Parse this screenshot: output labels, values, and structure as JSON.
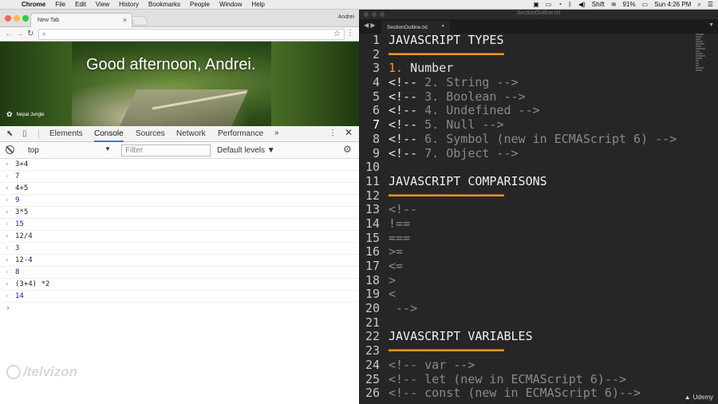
{
  "menubar": {
    "apple_icon": "apple-icon",
    "items": [
      "Chrome",
      "File",
      "Edit",
      "View",
      "History",
      "Bookmarks",
      "People",
      "Window",
      "Help"
    ],
    "status": {
      "shift": "Shift",
      "battery": "91%",
      "clock": "Sun 4:26 PM"
    }
  },
  "chrome": {
    "tab_title": "New Tab",
    "profile": "Andrei",
    "greeting": "Good afternoon, Andrei.",
    "photo_credit": "Nepal Jungle",
    "devtools": {
      "tabs": [
        "Elements",
        "Console",
        "Sources",
        "Network",
        "Performance"
      ],
      "active_tab": "Console",
      "more": "»"
    },
    "console_bar": {
      "context": "top",
      "filter_placeholder": "Filter",
      "levels": "Default levels ▼"
    },
    "console": [
      {
        "kind": "in",
        "text": "3+4"
      },
      {
        "kind": "out",
        "text": "7"
      },
      {
        "kind": "in",
        "text": "4+5"
      },
      {
        "kind": "out",
        "text": "9"
      },
      {
        "kind": "in",
        "text": "3*5"
      },
      {
        "kind": "out",
        "text": "15"
      },
      {
        "kind": "in",
        "text": "12/4"
      },
      {
        "kind": "out",
        "text": "3"
      },
      {
        "kind": "in",
        "text": "12-4"
      },
      {
        "kind": "out",
        "text": "8"
      },
      {
        "kind": "in",
        "text": "(3+4) *2"
      },
      {
        "kind": "out",
        "text": "14"
      }
    ],
    "watermark": "/telvizon"
  },
  "sublime": {
    "window_title": "SectionOutline.txt",
    "tab_title": "SectionOutline.txt",
    "lines": [
      {
        "n": "1",
        "parts": [
          {
            "c": "c-h1",
            "t": "JAVASCRIPT TYPES"
          }
        ]
      },
      {
        "n": "2",
        "parts": [
          {
            "c": "c-rule",
            "t": "━━━━━━━━━━━━━━━━"
          }
        ]
      },
      {
        "n": "3",
        "parts": [
          {
            "c": "c-num",
            "t": "1."
          },
          {
            "c": "c-plain",
            "t": " Number"
          }
        ]
      },
      {
        "n": "4",
        "parts": [
          {
            "c": "c-plain",
            "t": "<!-- "
          },
          {
            "c": "c-comment",
            "t": "2. String -->"
          }
        ]
      },
      {
        "n": "5",
        "parts": [
          {
            "c": "c-plain",
            "t": "<!-- "
          },
          {
            "c": "c-comment",
            "t": "3. Boolean -->"
          }
        ]
      },
      {
        "n": "6",
        "parts": [
          {
            "c": "c-plain",
            "t": "<!-- "
          },
          {
            "c": "c-comment",
            "t": "4. Undefined -->"
          }
        ]
      },
      {
        "n": "7",
        "parts": [
          {
            "c": "c-plain",
            "t": "<!-- "
          },
          {
            "c": "c-comment",
            "t": "5. Null -->"
          }
        ]
      },
      {
        "n": "8",
        "parts": [
          {
            "c": "c-plain",
            "t": "<!-- "
          },
          {
            "c": "c-comment",
            "t": "6. Symbol (new in ECMAScript 6) -->"
          }
        ]
      },
      {
        "n": "9",
        "parts": [
          {
            "c": "c-plain",
            "t": "<!-- "
          },
          {
            "c": "c-comment",
            "t": "7. Object -->"
          }
        ]
      },
      {
        "n": "10",
        "parts": []
      },
      {
        "n": "11",
        "parts": [
          {
            "c": "c-h1",
            "t": "JAVASCRIPT COMPARISONS"
          }
        ]
      },
      {
        "n": "12",
        "parts": [
          {
            "c": "c-rule",
            "t": "━━━━━━━━━━━━━━━━"
          }
        ]
      },
      {
        "n": "13",
        "parts": [
          {
            "c": "c-comment",
            "t": "<!--"
          }
        ]
      },
      {
        "n": "14",
        "parts": [
          {
            "c": "c-comment",
            "t": "!=="
          }
        ]
      },
      {
        "n": "15",
        "parts": [
          {
            "c": "c-comment",
            "t": "==="
          }
        ]
      },
      {
        "n": "16",
        "parts": [
          {
            "c": "c-comment",
            "t": ">="
          }
        ]
      },
      {
        "n": "17",
        "parts": [
          {
            "c": "c-comment",
            "t": "<="
          }
        ]
      },
      {
        "n": "18",
        "parts": [
          {
            "c": "c-comment",
            "t": ">"
          }
        ]
      },
      {
        "n": "19",
        "parts": [
          {
            "c": "c-comment",
            "t": "<"
          }
        ]
      },
      {
        "n": "20",
        "parts": [
          {
            "c": "c-comment",
            "t": " -->"
          }
        ]
      },
      {
        "n": "21",
        "parts": []
      },
      {
        "n": "22",
        "parts": [
          {
            "c": "c-h1",
            "t": "JAVASCRIPT VARIABLES"
          }
        ]
      },
      {
        "n": "23",
        "parts": [
          {
            "c": "c-rule",
            "t": "━━━━━━━━━━━━━━━━"
          }
        ]
      },
      {
        "n": "24",
        "parts": [
          {
            "c": "c-comment",
            "t": "<!-- var -->"
          }
        ]
      },
      {
        "n": "25",
        "parts": [
          {
            "c": "c-comment",
            "t": "<!-- let (new in ECMAScript 6)-->"
          }
        ]
      },
      {
        "n": "26",
        "parts": [
          {
            "c": "c-comment",
            "t": "<!-- const (new in ECMAScript 6)-->"
          }
        ]
      }
    ],
    "active_line": "7",
    "brand": "Udemy"
  },
  "colors": {
    "accent_orange": "#fd971f",
    "comment_gray": "#8a8a8a",
    "editor_bg": "#262626",
    "console_output_blue": "#1a1aa6",
    "devtools_tab_underline": "#3b78e7"
  }
}
